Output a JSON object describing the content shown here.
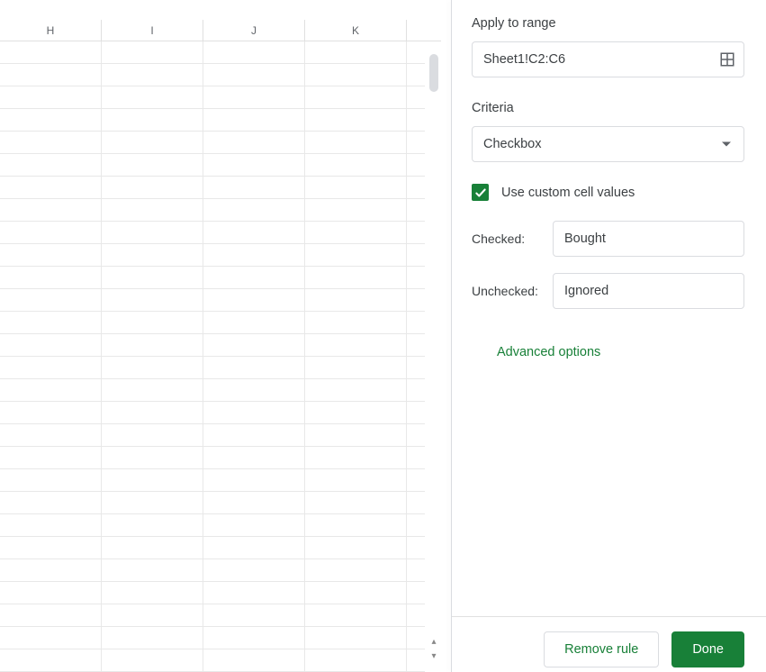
{
  "sheet": {
    "columns": [
      "H",
      "I",
      "J",
      "K"
    ],
    "visible_rows": 28
  },
  "panel": {
    "apply_range_label": "Apply to range",
    "apply_range_value": "Sheet1!C2:C6",
    "criteria_label": "Criteria",
    "criteria_value": "Checkbox",
    "custom_values_label": "Use custom cell values",
    "custom_values_checked": true,
    "checked_label": "Checked:",
    "checked_value": "Bought",
    "unchecked_label": "Unchecked:",
    "unchecked_value": "Ignored",
    "advanced_label": "Advanced options",
    "remove_label": "Remove rule",
    "done_label": "Done"
  }
}
